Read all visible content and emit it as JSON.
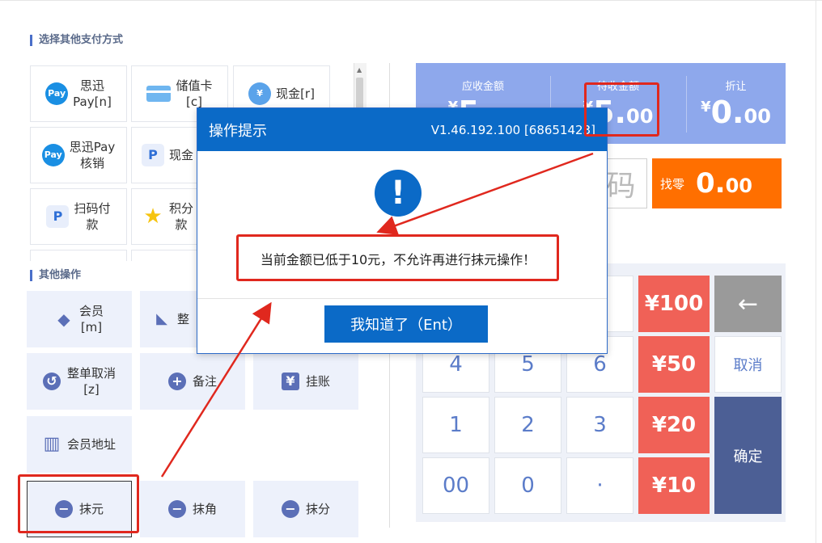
{
  "left": {
    "pay_section_title": "选择其他支付方式",
    "pay_methods": [
      {
        "label": "思迅\nPay[n]",
        "icon": "pay-icon",
        "color": "#1a8fe3",
        "icon_text": "Pay"
      },
      {
        "label": "储值卡\n[c]",
        "icon": "card-icon",
        "color": "#6fb6f0"
      },
      {
        "label": "现金[r]",
        "icon": "money-bag-icon",
        "color": "#5aa3ea",
        "icon_text": "¥"
      },
      {
        "label": "思迅Pay\n核销",
        "icon": "pay-icon",
        "color": "#1a8fe3",
        "icon_text": "Pay"
      },
      {
        "label": "现金",
        "icon": "paypal-icon",
        "color": "#2f6fd6",
        "icon_text": "P"
      },
      {
        "label": "扫码付\n款",
        "icon": "paypal-icon",
        "color": "#2f6fd6",
        "icon_text": "P"
      },
      {
        "label": "积分\n款",
        "icon": "star-icon",
        "color": "#f6c40f",
        "icon_text": "★"
      }
    ],
    "ops_section_title": "其他操作",
    "ops": [
      {
        "label": "会员\n[m]",
        "icon": "diamond-icon",
        "icon_text": "◆"
      },
      {
        "label": "整",
        "icon": "tag-icon",
        "icon_text": "◣"
      },
      {
        "label": "整单取消\n[z]",
        "icon": "undo-icon",
        "icon_text": "↺"
      },
      {
        "label": "备注",
        "icon": "plus-icon",
        "icon_text": "+"
      },
      {
        "label": "挂账",
        "icon": "yen-doc-icon",
        "icon_text": "¥"
      },
      {
        "label": "会员地址",
        "icon": "building-icon",
        "icon_text": "▥"
      },
      {
        "label": "抹元",
        "icon": "minus-icon",
        "icon_text": "−"
      },
      {
        "label": "抹角",
        "icon": "minus-icon",
        "icon_text": "−"
      },
      {
        "label": "抹分",
        "icon": "minus-icon",
        "icon_text": "−"
      }
    ]
  },
  "amounts": {
    "yen": "¥",
    "receivable_label": "应收金额",
    "receivable_int": "5.",
    "receivable_dec": "00",
    "pending_label": "待收金额",
    "pending_int": "5.",
    "pending_dec": "00",
    "discount_label": "折让",
    "discount_int": "0.",
    "discount_dec": "00"
  },
  "code_text": "码",
  "change": {
    "label": "找零",
    "int": "0.",
    "dec": "00"
  },
  "keypad": {
    "digits": [
      "4",
      "5",
      "6",
      "1",
      "2",
      "3",
      "00",
      "0",
      "·"
    ],
    "cash": [
      "¥100",
      "¥50",
      "¥20",
      "¥10"
    ],
    "backspace": "←",
    "cancel": "取消",
    "confirm": "确定"
  },
  "dialog": {
    "title": "操作提示",
    "version": "V1.46.192.100 [68651423]",
    "icon": "exclamation-icon",
    "message": "当前金额已低于10元，不允许再进行抹元操作！",
    "ok_button": "我知道了（Ent）"
  },
  "colors": {
    "primary": "#0b6ac7",
    "amount_panel": "#8ea8ec",
    "change": "#ff6f00",
    "cash_key": "#f06157",
    "confirm_key": "#4c5f95",
    "annotation": "#e0281e"
  }
}
